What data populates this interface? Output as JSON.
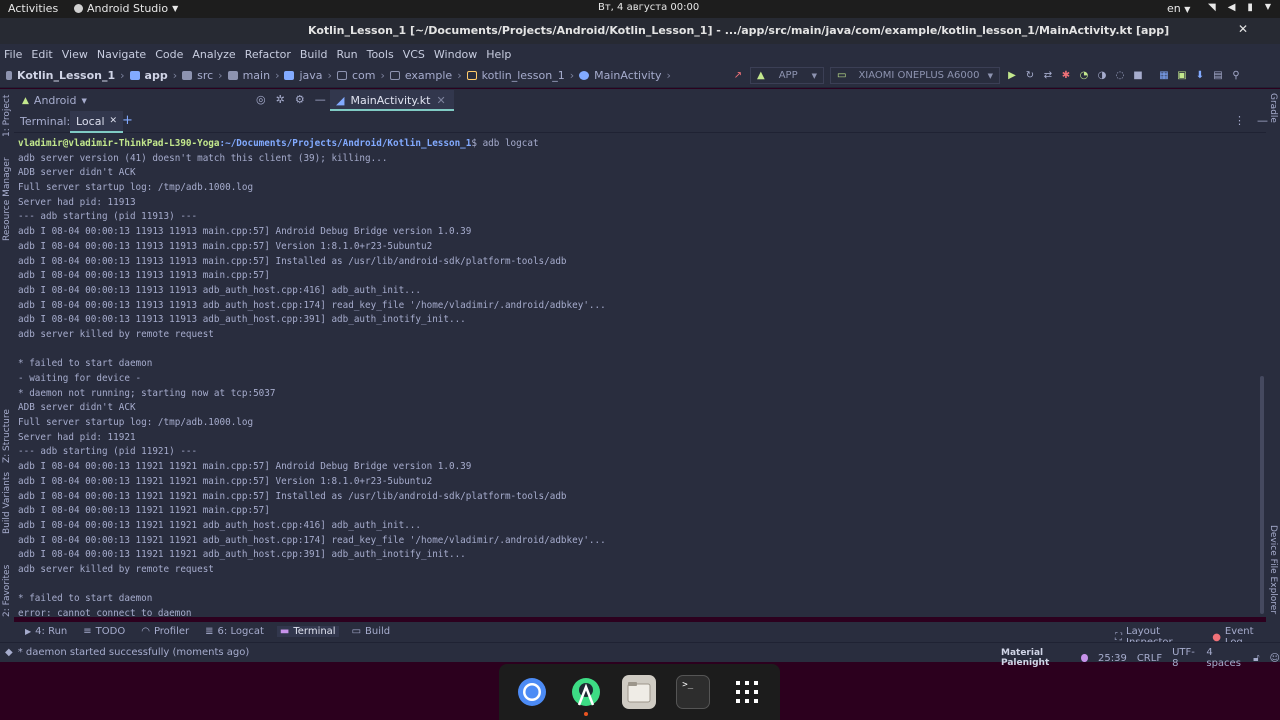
{
  "topbar": {
    "activities": "Activities",
    "app_name": "Android Studio",
    "clock": "Вт, 4 августа  00:00",
    "lang": "en"
  },
  "window": {
    "title": "Kotlin_Lesson_1 [~/Documents/Projects/Android/Kotlin_Lesson_1] - .../app/src/main/java/com/example/kotlin_lesson_1/MainActivity.kt [app]"
  },
  "menu": [
    "File",
    "Edit",
    "View",
    "Navigate",
    "Code",
    "Analyze",
    "Refactor",
    "Build",
    "Run",
    "Tools",
    "VCS",
    "Window",
    "Help"
  ],
  "breadcrumbs": [
    "Kotlin_Lesson_1",
    "app",
    "src",
    "main",
    "java",
    "com",
    "example",
    "kotlin_lesson_1",
    "MainActivity"
  ],
  "run": {
    "config": "APP",
    "device": "XIAOMI ONEPLUS A6000"
  },
  "project_pane": {
    "view": "Android"
  },
  "editor": {
    "tab": "MainActivity.kt"
  },
  "sidebars": {
    "left": [
      "1: Project",
      "Resource Manager",
      "Z: Structure",
      "Build Variants",
      "2: Favorites"
    ],
    "right": [
      "Gradle",
      "Device File Explorer"
    ]
  },
  "terminal": {
    "label": "Terminal:",
    "tab": "Local",
    "prompt_user": "vladimir@vladimir-ThinkPad-L390-Yoga",
    "prompt_path": ":~/Documents/Projects/Android/Kotlin_Lesson_1",
    "command": "$ adb logcat",
    "lines": [
      "adb server version (41) doesn't match this client (39); killing...",
      "ADB server didn't ACK",
      "Full server startup log: /tmp/adb.1000.log",
      "Server had pid: 11913",
      "--- adb starting (pid 11913) ---",
      "adb I 08-04 00:00:13 11913 11913 main.cpp:57] Android Debug Bridge version 1.0.39",
      "adb I 08-04 00:00:13 11913 11913 main.cpp:57] Version 1:8.1.0+r23-5ubuntu2",
      "adb I 08-04 00:00:13 11913 11913 main.cpp:57] Installed as /usr/lib/android-sdk/platform-tools/adb",
      "adb I 08-04 00:00:13 11913 11913 main.cpp:57]",
      "adb I 08-04 00:00:13 11913 11913 adb_auth_host.cpp:416] adb_auth_init...",
      "adb I 08-04 00:00:13 11913 11913 adb_auth_host.cpp:174] read_key_file '/home/vladimir/.android/adbkey'...",
      "adb I 08-04 00:00:13 11913 11913 adb_auth_host.cpp:391] adb_auth_inotify_init...",
      "adb server killed by remote request",
      "",
      "* failed to start daemon",
      "- waiting for device -",
      "* daemon not running; starting now at tcp:5037",
      "ADB server didn't ACK",
      "Full server startup log: /tmp/adb.1000.log",
      "Server had pid: 11921",
      "--- adb starting (pid 11921) ---",
      "adb I 08-04 00:00:13 11921 11921 main.cpp:57] Android Debug Bridge version 1.0.39",
      "adb I 08-04 00:00:13 11921 11921 main.cpp:57] Version 1:8.1.0+r23-5ubuntu2",
      "adb I 08-04 00:00:13 11921 11921 main.cpp:57] Installed as /usr/lib/android-sdk/platform-tools/adb",
      "adb I 08-04 00:00:13 11921 11921 main.cpp:57]",
      "adb I 08-04 00:00:13 11921 11921 adb_auth_host.cpp:416] adb_auth_init...",
      "adb I 08-04 00:00:13 11921 11921 adb_auth_host.cpp:174] read_key_file '/home/vladimir/.android/adbkey'...",
      "adb I 08-04 00:00:13 11921 11921 adb_auth_host.cpp:391] adb_auth_inotify_init...",
      "adb server killed by remote request",
      "",
      "* failed to start daemon",
      "error: cannot connect to daemon"
    ]
  },
  "tool_windows": {
    "left": [
      {
        "label": "4: Run",
        "icon": "play-icon"
      },
      {
        "label": "TODO",
        "icon": "list-icon"
      },
      {
        "label": "Profiler",
        "icon": "gauge-icon"
      },
      {
        "label": "6: Logcat",
        "icon": "logcat-icon"
      },
      {
        "label": "Terminal",
        "icon": "terminal-icon",
        "active": true
      },
      {
        "label": "Build",
        "icon": "hammer-icon"
      }
    ],
    "right": [
      {
        "label": "Layout Inspector",
        "icon": "inspector-icon"
      },
      {
        "label": "Event Log",
        "icon": "event-log-icon"
      }
    ]
  },
  "status": {
    "message": "* daemon started successfully (moments ago)",
    "theme": "Material Palenight",
    "position": "25:39",
    "line_sep": "CRLF",
    "encoding": "UTF-8",
    "indent": "4 spaces"
  },
  "dock": [
    "chromium-icon",
    "android-studio-icon",
    "files-icon",
    "terminal-app-icon",
    "app-grid-icon"
  ],
  "colors": {
    "accent": "#80cbc4",
    "background": "#292d3e",
    "prompt_user": "#c3e88d",
    "prompt_path": "#82aaff",
    "desktop": "#2c001e"
  }
}
